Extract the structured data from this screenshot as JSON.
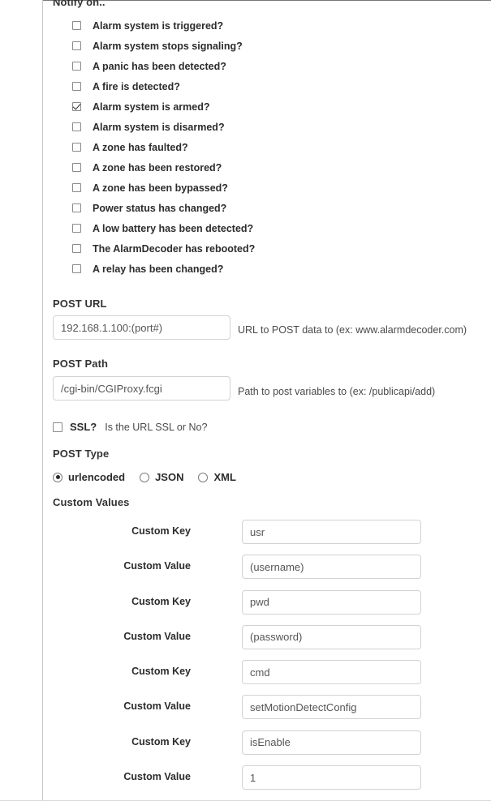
{
  "panel": {
    "notify_heading": "Notify on..",
    "notify_options": [
      {
        "label": "Alarm system is triggered?",
        "checked": false
      },
      {
        "label": "Alarm system stops signaling?",
        "checked": false
      },
      {
        "label": "A panic has been detected?",
        "checked": false
      },
      {
        "label": "A fire is detected?",
        "checked": false
      },
      {
        "label": "Alarm system is armed?",
        "checked": true
      },
      {
        "label": "Alarm system is disarmed?",
        "checked": false
      },
      {
        "label": "A zone has faulted?",
        "checked": false
      },
      {
        "label": "A zone has been restored?",
        "checked": false
      },
      {
        "label": "A zone has been bypassed?",
        "checked": false
      },
      {
        "label": "Power status has changed?",
        "checked": false
      },
      {
        "label": "A low battery has been detected?",
        "checked": false
      },
      {
        "label": "The AlarmDecoder has rebooted?",
        "checked": false
      },
      {
        "label": "A relay has been changed?",
        "checked": false
      }
    ],
    "post_url": {
      "label": "POST URL",
      "value": "192.168.1.100:(port#)",
      "helper": "URL to POST data to (ex: www.alarmdecoder.com)"
    },
    "post_path": {
      "label": "POST Path",
      "value": "/cgi-bin/CGIProxy.fcgi",
      "helper": "Path to post variables to (ex: /publicapi/add)"
    },
    "ssl": {
      "label": "SSL?",
      "helper": "Is the URL SSL or No?",
      "checked": false
    },
    "post_type": {
      "label": "POST Type",
      "selected": "urlencoded",
      "options": [
        "urlencoded",
        "JSON",
        "XML"
      ]
    },
    "custom_values": {
      "label": "Custom Values",
      "rows": [
        {
          "label": "Custom Key",
          "value": "usr"
        },
        {
          "label": "Custom Value",
          "value": "(username)"
        },
        {
          "label": "Custom Key",
          "value": "pwd"
        },
        {
          "label": "Custom Value",
          "value": "(password)"
        },
        {
          "label": "Custom Key",
          "value": "cmd"
        },
        {
          "label": "Custom Value",
          "value": "setMotionDetectConfig"
        },
        {
          "label": "Custom Key",
          "value": "isEnable"
        },
        {
          "label": "Custom Value",
          "value": "1"
        }
      ]
    }
  },
  "colors": {
    "text": "#2b2b2b",
    "border": "#d2d2d2",
    "divider": "#c8c8c8"
  }
}
